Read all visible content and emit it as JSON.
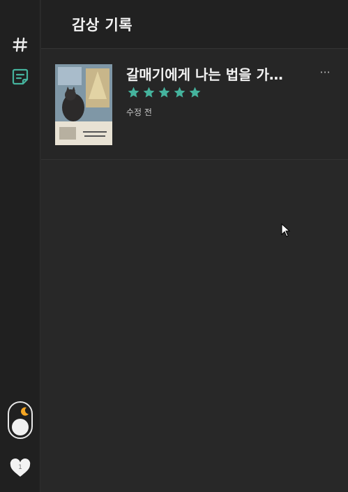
{
  "colors": {
    "accent": "#45b39d",
    "background": "#282828",
    "sidebar": "#202020",
    "moon": "#f5a623"
  },
  "sidebar": {
    "items": [
      {
        "icon": "hash-icon"
      },
      {
        "icon": "note-icon",
        "active": true
      }
    ],
    "theme_toggle": {
      "icon": "moon-icon",
      "mode": "dark"
    },
    "like": {
      "icon": "heart-icon",
      "count": "1"
    }
  },
  "header": {
    "title": "감상 기록"
  },
  "records": [
    {
      "title": "갈매기에게 나는 법을 가르쳐 준 고양이",
      "rating": 5,
      "max_rating": 5,
      "status": "수정 전",
      "more_label": "···"
    }
  ]
}
